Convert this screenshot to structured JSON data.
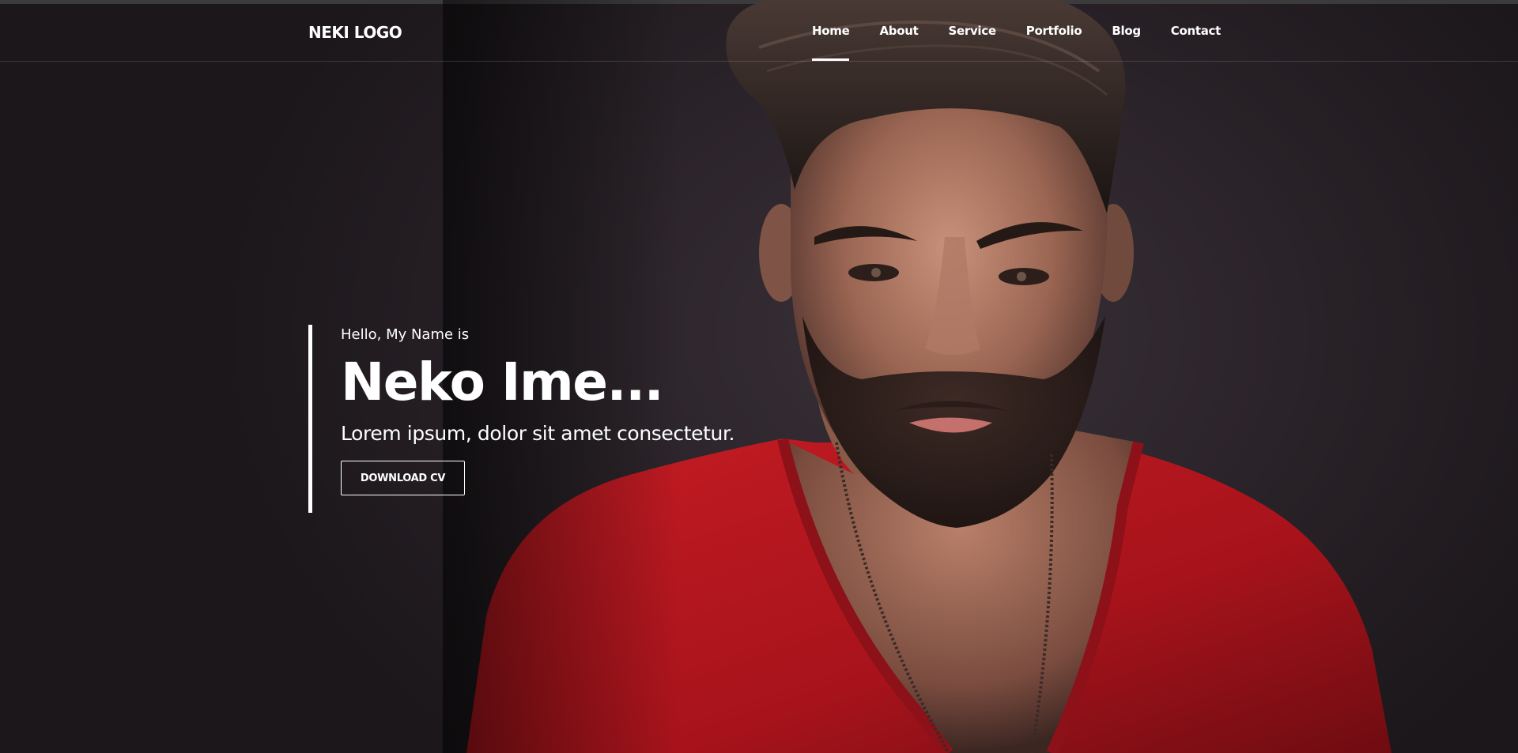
{
  "header": {
    "logo": "NEKI LOGO",
    "nav": [
      {
        "label": "Home",
        "active": true
      },
      {
        "label": "About",
        "active": false
      },
      {
        "label": "Service",
        "active": false
      },
      {
        "label": "Portfolio",
        "active": false
      },
      {
        "label": "Blog",
        "active": false
      },
      {
        "label": "Contact",
        "active": false
      }
    ]
  },
  "hero": {
    "greeting": "Hello, My Name is",
    "name": "Neko Ime...",
    "tagline": "Lorem ipsum, dolor sit amet consectetur.",
    "cta_label": "DOWNLOAD CV",
    "background_image": "portrait of a bearded man with styled hair in a red v-neck t-shirt and bead necklace on a dark background"
  },
  "colors": {
    "background": "#231d22",
    "text": "#ffffff",
    "shirt": "#b3141d",
    "accent_border": "#ffffff"
  }
}
